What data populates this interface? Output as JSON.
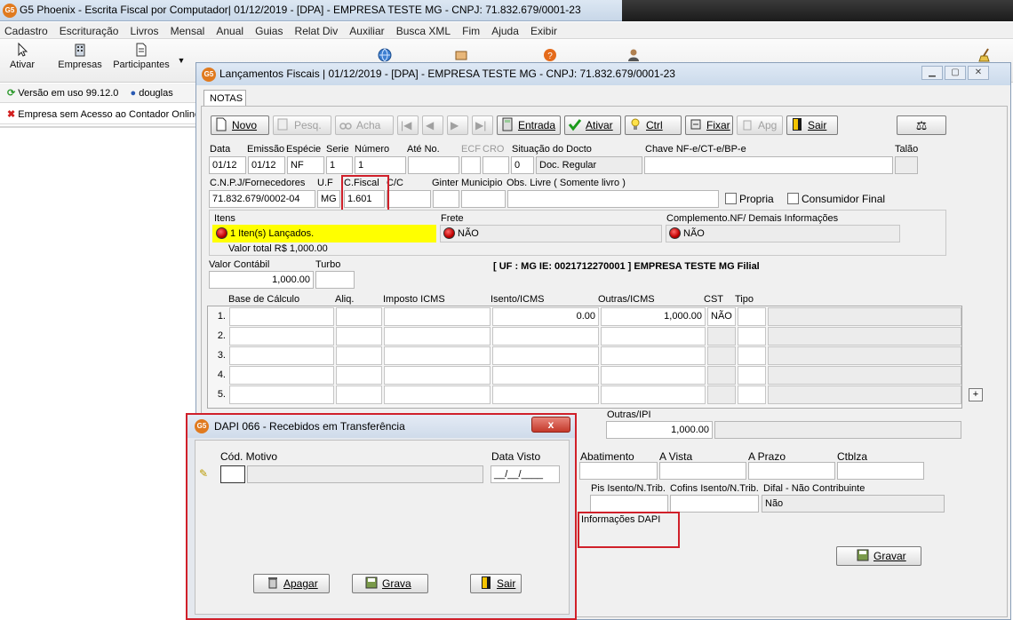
{
  "window": {
    "title": "G5 Phoenix - Escrita Fiscal por Computador|  01/12/2019 - [DPA] - EMPRESA TESTE MG - CNPJ: 71.832.679/0001-23",
    "logo_text": "G5"
  },
  "menu": [
    "Cadastro",
    "Escrituração",
    "Livros",
    "Mensal",
    "Anual",
    "Guias",
    "Relat Div",
    "Auxiliar",
    "Busca XML",
    "Fim",
    "Ajuda",
    "Exibir"
  ],
  "toolbar": {
    "ativar": "Ativar",
    "empresas": "Empresas",
    "participantes": "Participantes"
  },
  "status": {
    "versao": "Versão em uso 99.12.0",
    "usuario": "douglas",
    "aviso": "Empresa sem Acesso ao Contador Online"
  },
  "child": {
    "title": "Lançamentos Fiscais |  01/12/2019 - [DPA] - EMPRESA TESTE MG - CNPJ: 71.832.679/0001-23",
    "tab": "NOTAS",
    "buttons": {
      "novo": "Novo",
      "pesq": "Pesq.",
      "acha": "Acha",
      "entrada": "Entrada",
      "ativar": "Ativar",
      "ctrl": "Ctrl",
      "fixar": "Fixar",
      "apg": "Apg",
      "sair": "Sair",
      "gravar": "Gravar"
    },
    "labels": {
      "data": "Data",
      "emissao": "Emissão",
      "especie": "Espécie",
      "serie": "Serie",
      "numero": "Número",
      "ate_no": "Até No.",
      "ecf": "ECF",
      "cro": "CRO",
      "situacao": "Situação do Docto",
      "chave": "Chave NF-e/CT-e/BP-e",
      "talao": "Talão",
      "cnpj": "C.N.P.J/Fornecedores",
      "uf": "U.F",
      "cfiscal": "C.Fiscal",
      "cc": "C/C",
      "ginter": "Ginter",
      "municipio": "Municipio",
      "obs": "Obs. Livre ( Somente livro )",
      "propria": "Propria",
      "consumidor_final": "Consumidor Final",
      "itens": "Itens",
      "frete": "Frete",
      "complemento": "Complemento.NF/ Demais Informações",
      "valor_contabil": "Valor Contábil",
      "turbo": "Turbo",
      "uf_ie": "[ UF : MG IE: 0021712270001 ] EMPRESA TESTE MG Filial",
      "base_calculo": "Base de Cálculo",
      "aliq": "Aliq.",
      "imposto_icms": "Imposto ICMS",
      "isento_icms": "Isento/ICMS",
      "outras_icms": "Outras/ICMS",
      "cst": "CST",
      "tipo": "Tipo",
      "outras_ipi": "Outras/IPI",
      "abatimento": "Abatimento",
      "a_vista": "A Vista",
      "a_prazo": "A Prazo",
      "ctblza": "Ctblza",
      "pis_isento": "Pis Isento/N.Trib.",
      "cofins_isento": "Cofins Isento/N.Trib.",
      "difal": "Difal - Não Contribuinte",
      "info_dapi": "Informações DAPI"
    },
    "values": {
      "data": "01/12",
      "emissao": "01/12",
      "especie": "NF",
      "serie": "1",
      "numero": "1",
      "situacao_cod": "0",
      "situacao_desc": "Doc. Regular",
      "cnpj": "71.832.679/0002-04",
      "uf": "MG",
      "cfiscal": "1.601",
      "itens_status": "1 Iten(s) Lançados.",
      "valor_total": "Valor total R$ 1,000.00",
      "frete": "NÃO",
      "complemento": "NÃO",
      "valor_contabil": "1,000.00",
      "outras_ipi": "1,000.00",
      "difal": "Não"
    },
    "grid_rows": [
      {
        "n": "1.",
        "isento": "0.00",
        "outras": "1,000.00",
        "cst": "NÃO"
      },
      {
        "n": "2.",
        "isento": "",
        "outras": "",
        "cst": ""
      },
      {
        "n": "3.",
        "isento": "",
        "outras": "",
        "cst": ""
      },
      {
        "n": "4.",
        "isento": "",
        "outras": "",
        "cst": ""
      },
      {
        "n": "5.",
        "isento": "",
        "outras": "",
        "cst": ""
      }
    ],
    "plus": "+"
  },
  "dialog": {
    "title": "DAPI 066 - Recebidos em Transferência",
    "close": "x",
    "cod_motivo": "Cód. Motivo",
    "data_visto": "Data Visto",
    "data_visto_value": "__/__/____",
    "apagar": "Apagar",
    "grava": "Grava",
    "sair": "Sair"
  },
  "colors": {
    "highlight_red": "#d0202a",
    "items_yellow": "#ffff00",
    "title_blue": "#cbdaeb"
  }
}
